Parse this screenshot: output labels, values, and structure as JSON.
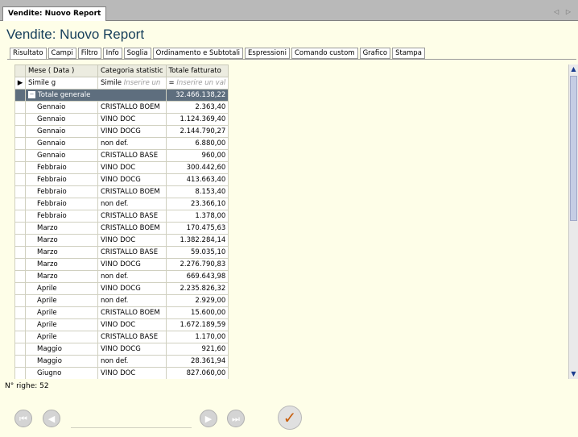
{
  "window": {
    "doc_tab": "Vendite: Nuovo Report",
    "title": "Vendite: Nuovo Report",
    "nav_arrows": "◁ ▷"
  },
  "tabs": [
    "Risultato",
    "Campi",
    "Filtro",
    "Info",
    "Soglia",
    "Ordinamento e Subtotali",
    "Espressioni",
    "Comando custom",
    "Grafico",
    "Stampa"
  ],
  "grid": {
    "columns": [
      "Mese ( Data )",
      "Categoria statistic",
      "Totale fatturato"
    ],
    "filter": {
      "c1_op": "Simile",
      "c1_val": "g",
      "c2_op": "Simile",
      "c2_ph": "Inserire un",
      "c3_op": "=",
      "c3_ph": "Inserire un val"
    },
    "group_label": "Totale generale",
    "group_total": "32.466.138,22",
    "rows": [
      [
        "Gennaio",
        "CRISTALLO BOEM",
        "2.363,40"
      ],
      [
        "Gennaio",
        "VINO DOC",
        "1.124.369,40"
      ],
      [
        "Gennaio",
        "VINO DOCG",
        "2.144.790,27"
      ],
      [
        "Gennaio",
        "non def.",
        "6.880,00"
      ],
      [
        "Gennaio",
        "CRISTALLO BASE",
        "960,00"
      ],
      [
        "Febbraio",
        "VINO DOC",
        "300.442,60"
      ],
      [
        "Febbraio",
        "VINO DOCG",
        "413.663,40"
      ],
      [
        "Febbraio",
        "CRISTALLO BOEM",
        "8.153,40"
      ],
      [
        "Febbraio",
        "non def.",
        "23.366,10"
      ],
      [
        "Febbraio",
        "CRISTALLO BASE",
        "1.378,00"
      ],
      [
        "Marzo",
        "CRISTALLO BOEM",
        "170.475,63"
      ],
      [
        "Marzo",
        "VINO DOC",
        "1.382.284,14"
      ],
      [
        "Marzo",
        "CRISTALLO BASE",
        "59.035,10"
      ],
      [
        "Marzo",
        "VINO DOCG",
        "2.276.790,83"
      ],
      [
        "Marzo",
        "non def.",
        "669.643,98"
      ],
      [
        "Aprile",
        "VINO DOCG",
        "2.235.826,32"
      ],
      [
        "Aprile",
        "non def.",
        "2.929,00"
      ],
      [
        "Aprile",
        "CRISTALLO BOEM",
        "15.600,00"
      ],
      [
        "Aprile",
        "VINO DOC",
        "1.672.189,59"
      ],
      [
        "Aprile",
        "CRISTALLO BASE",
        "1.170,00"
      ],
      [
        "Maggio",
        "VINO DOCG",
        "921,60"
      ],
      [
        "Maggio",
        "non def.",
        "28.361,94"
      ],
      [
        "Giugno",
        "VINO DOC",
        "827.060,00"
      ]
    ]
  },
  "status": {
    "row_count": "N° righe: 52"
  }
}
